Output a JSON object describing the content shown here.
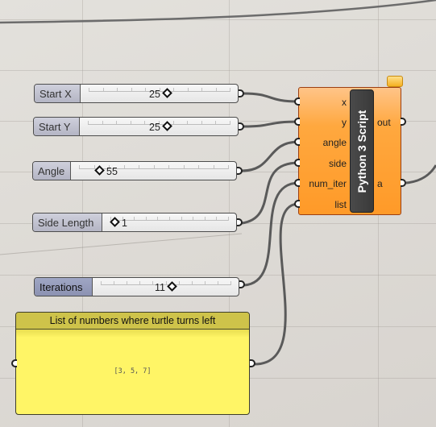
{
  "canvas": {
    "background": "#dedbd5",
    "wire_color": "#5a5a5a"
  },
  "sliders": [
    {
      "name": "start-x",
      "label": "Start X",
      "value": "25",
      "value_side": "left",
      "selected": false
    },
    {
      "name": "start-y",
      "label": "Start Y",
      "value": "25",
      "value_side": "left",
      "selected": false
    },
    {
      "name": "angle",
      "label": "Angle",
      "value": "55",
      "value_side": "right",
      "selected": false
    },
    {
      "name": "side-length",
      "label": "Side Length",
      "value": "1",
      "value_side": "right",
      "selected": false
    },
    {
      "name": "iterations",
      "label": "Iterations",
      "value": "11",
      "value_side": "left",
      "selected": true
    }
  ],
  "component": {
    "name": "Python 3 Script",
    "color": "#ff9a28",
    "inputs": [
      "x",
      "y",
      "angle",
      "side",
      "num_iter",
      "list"
    ],
    "outputs": [
      "out",
      "a"
    ],
    "has_message_balloon": true
  },
  "panel": {
    "title": "List of numbers where turtle turns left",
    "content": "[3, 5, 7]",
    "color": "#fff566"
  }
}
